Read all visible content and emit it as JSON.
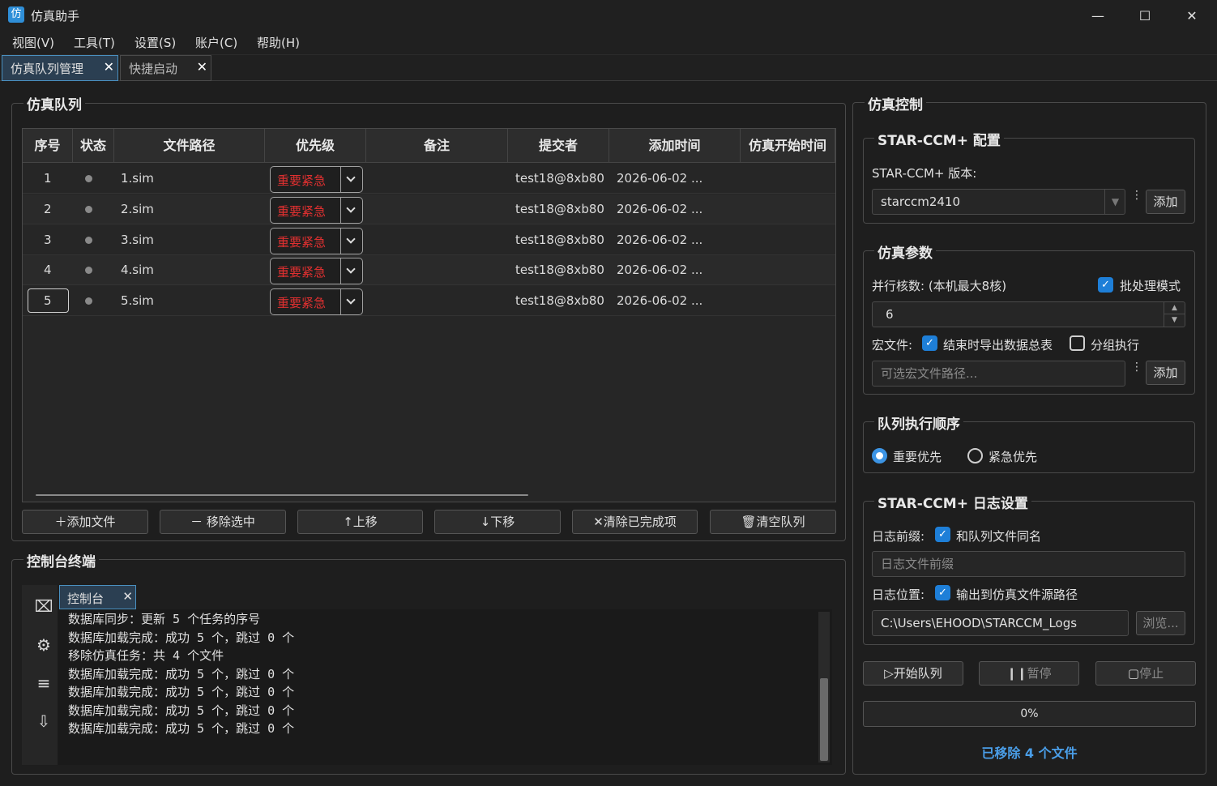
{
  "window": {
    "title": "仿真助手",
    "app_icon_char": "仿",
    "minimize": "—",
    "maximize": "☐",
    "close": "✕"
  },
  "menu": [
    "视图(V)",
    "工具(T)",
    "设置(S)",
    "账户(C)",
    "帮助(H)"
  ],
  "tabs": [
    {
      "label": "仿真队列管理",
      "active": true
    },
    {
      "label": "快捷启动",
      "active": false
    }
  ],
  "queue": {
    "title": "仿真队列",
    "columns": [
      "序号",
      "状态",
      "文件路径",
      "优先级",
      "备注",
      "提交者",
      "添加时间",
      "仿真开始时间"
    ],
    "rows": [
      {
        "index": "1",
        "file": "1.sim",
        "priority": "重要紧急",
        "note": "",
        "submitter": "test18@8xb80",
        "added": "2026-06-02 ..."
      },
      {
        "index": "2",
        "file": "2.sim",
        "priority": "重要紧急",
        "note": "",
        "submitter": "test18@8xb80",
        "added": "2026-06-02 ..."
      },
      {
        "index": "3",
        "file": "3.sim",
        "priority": "重要紧急",
        "note": "",
        "submitter": "test18@8xb80",
        "added": "2026-06-02 ..."
      },
      {
        "index": "4",
        "file": "4.sim",
        "priority": "重要紧急",
        "note": "",
        "submitter": "test18@8xb80",
        "added": "2026-06-02 ..."
      },
      {
        "index": "5",
        "file": "5.sim",
        "priority": "重要紧急",
        "note": "",
        "submitter": "test18@8xb80",
        "added": "2026-06-02 ..."
      }
    ],
    "buttons": {
      "add": "添加文件",
      "remove": "移除选中",
      "up": "上移",
      "down": "下移",
      "clear_done": "清除已完成项",
      "clear_all": "清空队列"
    }
  },
  "console": {
    "title": "控制台终端",
    "tab": "控制台",
    "lines": [
      "数据库同步：更新 5 个任务的序号",
      "数据库加载完成：成功 5 个，跳过 0 个",
      "移除仿真任务：共 4 个文件",
      "数据库加载完成：成功 5 个，跳过 0 个",
      "数据库加载完成：成功 5 个，跳过 0 个",
      "数据库加载完成：成功 5 个，跳过 0 个",
      "数据库加载完成：成功 5 个，跳过 0 个"
    ]
  },
  "control": {
    "title": "仿真控制",
    "starccm": {
      "title": "STAR-CCM+ 配置",
      "version_label": "STAR-CCM+ 版本:",
      "version": "starccm2410",
      "add": "添加"
    },
    "params": {
      "title": "仿真参数",
      "cores_label": "并行核数: (本机最大8核)",
      "batch_label": "批处理模式",
      "cores": "6",
      "macro_label": "宏文件:",
      "export_label": "结束时导出数据总表",
      "group_label": "分组执行",
      "macro_placeholder": "可选宏文件路径...",
      "add": "添加"
    },
    "order": {
      "title": "队列执行顺序",
      "important": "重要优先",
      "urgent": "紧急优先"
    },
    "log": {
      "title": "STAR-CCM+ 日志设置",
      "prefix_label": "日志前缀:",
      "same_name_label": "和队列文件同名",
      "prefix_placeholder": "日志文件前缀",
      "location_label": "日志位置:",
      "output_src_label": "输出到仿真文件源路径",
      "path": "C:\\Users\\EHOOD\\STARCCM_Logs",
      "browse": "浏览..."
    },
    "start": "开始队列",
    "pause": "暂停",
    "stop": "停止",
    "progress": "0%",
    "progress_value": 0,
    "status": "已移除 4 个文件"
  },
  "colors": {
    "accent": "#1e7fd8",
    "status_text": "#4a9ee8",
    "priority_text": "#e03030"
  }
}
